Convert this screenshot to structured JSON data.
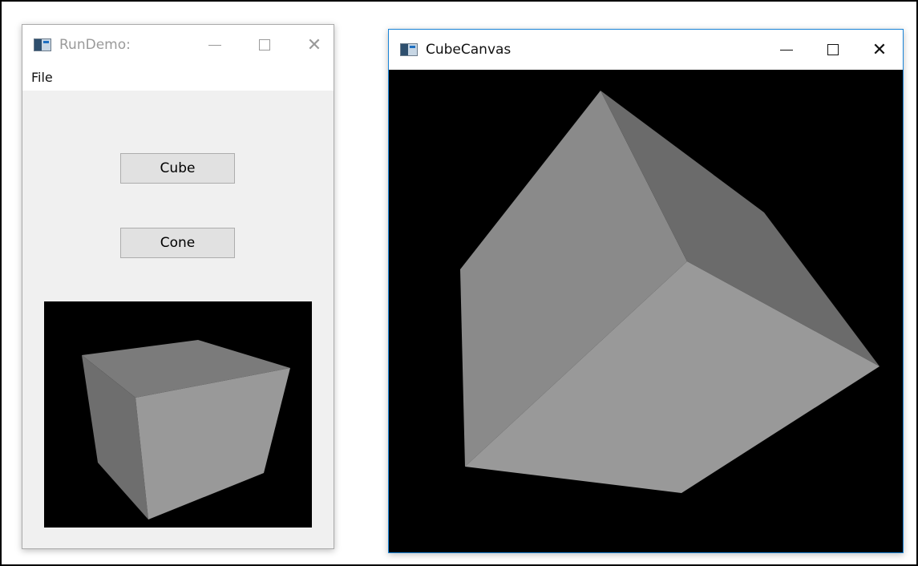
{
  "windows": {
    "rundemo": {
      "title": "RunDemo:",
      "menu": [
        "File"
      ],
      "buttons": {
        "cube": "Cube",
        "cone": "Cone"
      },
      "controls": {
        "minimize": "minimize-icon",
        "maximize": "maximize-icon",
        "close": "close-icon"
      }
    },
    "cube_canvas": {
      "title": "CubeCanvas",
      "controls": {
        "minimize": "minimize-icon",
        "maximize": "maximize-icon",
        "close": "close-icon"
      }
    }
  },
  "colors": {
    "canvas_background": "#000000",
    "face_light": "#999999",
    "face_mid": "#8a8a8a",
    "face_dark": "#6b6b6b",
    "window_background": "#f0f0f0",
    "active_border": "#1883d7"
  }
}
